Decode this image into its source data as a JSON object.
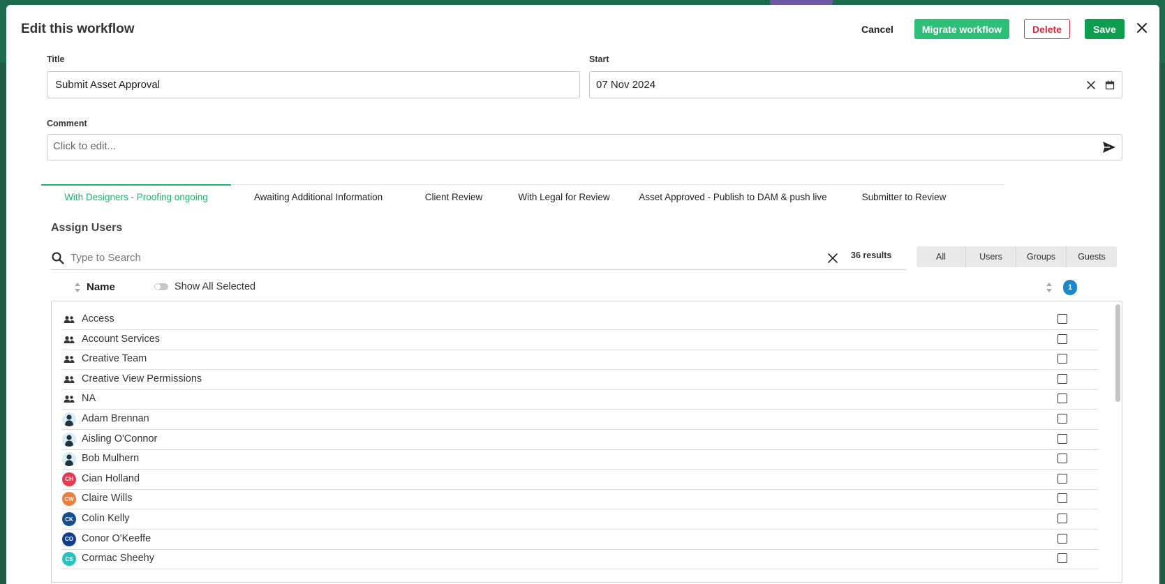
{
  "dialog": {
    "title": "Edit this workflow",
    "cancel_label": "Cancel",
    "migrate_label": "Migrate workflow",
    "delete_label": "Delete",
    "save_label": "Save"
  },
  "form": {
    "title_label": "Title",
    "title_value": "Submit Asset Approval",
    "start_label": "Start",
    "start_value": "07 Nov 2024",
    "comment_label": "Comment",
    "comment_placeholder": "Click to edit..."
  },
  "tabs": [
    {
      "label": "With Designers - Proofing ongoing",
      "active": true
    },
    {
      "label": "Awaiting Additional Information",
      "active": false
    },
    {
      "label": "Client Review",
      "active": false
    },
    {
      "label": "With Legal for Review",
      "active": false
    },
    {
      "label": "Asset Approved - Publish to DAM & push live",
      "active": false
    },
    {
      "label": "Submitter to Review",
      "active": false
    }
  ],
  "assign": {
    "title": "Assign Users",
    "search_placeholder": "Type to Search",
    "results": "36 results",
    "filters": [
      "All",
      "Users",
      "Groups",
      "Guests"
    ],
    "name_column": "Name",
    "show_all_selected_label": "Show All Selected",
    "selected_count": "1"
  },
  "rows": [
    {
      "name": "Access",
      "type": "group",
      "checked": false
    },
    {
      "name": "Account Services",
      "type": "group",
      "checked": false
    },
    {
      "name": "Creative Team",
      "type": "group",
      "checked": false
    },
    {
      "name": "Creative View Permissions",
      "type": "group",
      "checked": false
    },
    {
      "name": "NA",
      "type": "group",
      "checked": false
    },
    {
      "name": "Adam Brennan",
      "type": "person",
      "checked": false
    },
    {
      "name": "Aisling O'Connor",
      "type": "person",
      "checked": false
    },
    {
      "name": "Bob Mulhern",
      "type": "person",
      "checked": false
    },
    {
      "name": "Cian Holland",
      "type": "initials",
      "initials": "CH",
      "color": "#e8384f",
      "checked": false
    },
    {
      "name": "Claire Wills",
      "type": "initials",
      "initials": "CW",
      "color": "#f07c3a",
      "checked": false
    },
    {
      "name": "Colin Kelly",
      "type": "initials",
      "initials": "CK",
      "color": "#14508f",
      "checked": false
    },
    {
      "name": "Conor O'Keeffe",
      "type": "initials",
      "initials": "CO",
      "color": "#123f8c",
      "checked": false
    },
    {
      "name": "Cormac Sheehy",
      "type": "initials",
      "initials": "CS",
      "color": "#27c3c1",
      "checked": false
    }
  ],
  "colors": {
    "accent_green": "#23b26d",
    "migrate_green": "#2dbe78",
    "save_green": "#0e9c4e",
    "delete_red": "#d62b3a",
    "badge_blue": "#1d87c9"
  },
  "icons": {
    "close": "close-icon",
    "clear": "clear-icon",
    "calendar": "calendar-icon",
    "send": "send-icon",
    "search": "search-icon",
    "sort": "sort-icon",
    "group": "group-icon",
    "person": "person-icon"
  }
}
